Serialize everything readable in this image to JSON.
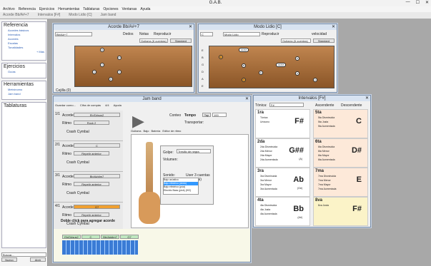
{
  "app": {
    "title": "G.A.B.",
    "minimize": "—",
    "maximize": "☐",
    "close": "✕"
  },
  "menu": [
    "Archivo",
    "Referencia",
    "Ejercicios",
    "Herramientas",
    "Tablaturas",
    "Opciones",
    "Ventanas",
    "Ayuda"
  ],
  "tabs": [
    "Acorde Bb/A#+7",
    "Intervalos [F#]",
    "Modo Lidio [C]",
    "Jam band"
  ],
  "sidebar": {
    "referencia": {
      "title": "Referencia",
      "items": [
        "Acordes básicos",
        "Intervalos",
        "Acordes",
        "Escalas",
        "Tonalidades"
      ],
      "more": "+ Más"
    },
    "ejercicios": {
      "title": "Ejercicios",
      "items": [
        "Guías"
      ]
    },
    "herramientas": {
      "title": "Herramientas",
      "items": [
        "Metrónomo",
        "Jam band"
      ]
    },
    "tablaturas": {
      "title": "Tablaturas"
    },
    "search_label": "Buscar...",
    "new": "Nuevo",
    "open": "Abrir"
  },
  "acorde": {
    "title": "Acorde Bb/A#+7",
    "root": "Bb",
    "chord": "Bb/A#+7",
    "opt1": "Dedos",
    "opt2": "Notas",
    "play": "Reproducir",
    "instrument": "Guitarra (6 cuerdas)",
    "tuning": "Standard",
    "capo": "Cejilla (0)",
    "dots": [
      "R",
      "b7",
      "3",
      "5",
      "R",
      "3"
    ]
  },
  "modo": {
    "title": "Modo Lidio [C]",
    "root": "C",
    "mode": "Modo Lidio",
    "play": "Reproducir",
    "speed": "velocidad",
    "instrument": "Guitarra (6 cuerdas)",
    "tuning": "Standard",
    "strings": [
      "E",
      "B",
      "G",
      "D",
      "A",
      "E"
    ],
    "notes": [
      "Gb/F#",
      "C",
      "D",
      "B",
      "E",
      "G",
      "A"
    ]
  },
  "jam": {
    "title": "Jam band",
    "save": "Guardar como...",
    "bpm_label": "Cifra de compás",
    "bpm_val": "4/4",
    "help": "Ayuda",
    "tempo": "Tempo",
    "tap": "Tap",
    "tempo_val": "100",
    "transport": "Transportar:",
    "conteo": "Conteo",
    "tracks": [
      {
        "n": "1/1",
        "chord": "Eb/D#sus2",
        "ritmo": "Rock 2"
      },
      {
        "n": "2/1",
        "chord": "C",
        "ritmo": "Repetir anterior"
      },
      {
        "n": "3/1",
        "chord": "Bb/A#dim7",
        "ritmo": "Repetir anterior"
      },
      {
        "n": "4/1",
        "chord": "G7",
        "ritmo": "Repetir anterior"
      }
    ],
    "acorde_label": "Acorde",
    "ritmo_label": "Ritmo",
    "crash": "Crash Cymbal",
    "add_hint": "Doble click para agregar acorde",
    "tabs": [
      "Guitarra",
      "Bajo",
      "Batería",
      "Editor de ritmo"
    ],
    "golpe_label": "Golpe:",
    "golpe": "Tresillo de negra",
    "volumen": "Volumen:",
    "sonido": "Sonido:",
    "count_label": "User 3 cuentas (Bs en Si)",
    "sounds": [
      "Bajo acústico",
      "Bajo eléctrico (dedo)",
      "Bajo eléctrico (púa)",
      "Electric Bass (pick) (HG)"
    ],
    "timeline": [
      "Eb/D#sus2",
      "C",
      "Bb/A#dim7",
      "G7"
    ]
  },
  "intervalos": {
    "title": "Intervalos [F#]",
    "tonica_label": "Tónica:",
    "tonica": "F#",
    "asc": "Ascendente",
    "desc": "Descendente",
    "blocks": [
      {
        "t": "1ra",
        "big": "F#",
        "rows": [
          "Tónica",
          "Unísono"
        ],
        "color": "#ffffff"
      },
      {
        "t": "5ta",
        "big": "C",
        "rows": [
          "5ta Disminuida",
          "5ta Justa",
          "5ta Aumentada"
        ],
        "color": "#fde9d9"
      },
      {
        "t": "2da",
        "big": "G##",
        "sub": "(A)",
        "rows": [
          "2da Disminuida",
          "2da Menor",
          "2da Mayor",
          "2da Aumentada"
        ],
        "color": "#ffffff"
      },
      {
        "t": "6ta",
        "big": "D#",
        "rows": [
          "6ta Disminuida",
          "6ta Menor",
          "6ta Mayor",
          "6ta Aumentada"
        ],
        "color": "#fde9d9"
      },
      {
        "t": "3ra",
        "big": "Ab",
        "sub": "(G#)",
        "rows": [
          "3ra Disminuida",
          "3ra Menor",
          "3ra Mayor",
          "3ra Aumentada"
        ],
        "color": "#ffffff"
      },
      {
        "t": "7ma",
        "big": "E",
        "rows": [
          "7ma Disminuida",
          "7ma Menor",
          "7ma Mayor",
          "7ma Aumentada"
        ],
        "color": "#fde9d9"
      },
      {
        "t": "4ta",
        "big": "Bb",
        "sub": "(A#)",
        "rows": [
          "4ta Disminuida",
          "4ta Justa",
          "4ta Aumentada"
        ],
        "color": "#ffffff"
      },
      {
        "t": "8va",
        "big": "F#",
        "rows": [
          "8va Justa"
        ],
        "color": "#fbf3c8"
      }
    ]
  }
}
